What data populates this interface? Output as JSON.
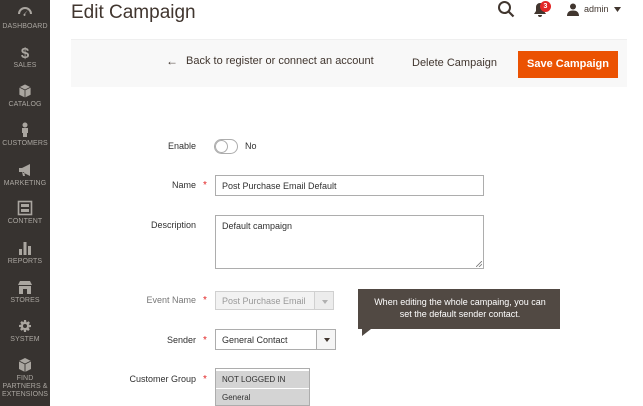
{
  "sidebar": {
    "items": [
      {
        "label": "Dashboard",
        "icon": "dashboard-icon"
      },
      {
        "label": "Sales",
        "icon": "dollar-icon"
      },
      {
        "label": "Catalog",
        "icon": "box-icon"
      },
      {
        "label": "Customers",
        "icon": "person-icon"
      },
      {
        "label": "Marketing",
        "icon": "megaphone-icon"
      },
      {
        "label": "Content",
        "icon": "layout-icon"
      },
      {
        "label": "Reports",
        "icon": "bar-chart-icon"
      },
      {
        "label": "Stores",
        "icon": "store-icon"
      },
      {
        "label": "System",
        "icon": "gear-icon"
      },
      {
        "label": "Find Partners & Extensions",
        "icon": "cube-icon"
      }
    ]
  },
  "header": {
    "title": "Edit Campaign",
    "notification_count": "3",
    "user_name": "admin"
  },
  "actions": {
    "back_label": "Back to register or connect an account",
    "back_arrow": "←",
    "delete_label": "Delete Campaign",
    "save_label": "Save Campaign"
  },
  "form": {
    "enable_label": "Enable",
    "enable_value": "No",
    "name_label": "Name",
    "name_value": "Post Purchase Email Default",
    "description_label": "Description",
    "description_value": "Default campaign",
    "event_name_label": "Event Name",
    "event_name_value": "Post Purchase Email",
    "sender_label": "Sender",
    "sender_value": "General Contact",
    "sender_tooltip": "When editing the whole campaing, you can set the default sender contact.",
    "customer_group_label": "Customer Group",
    "customer_group_options": [
      "NOT LOGGED IN",
      "General"
    ]
  },
  "colors": {
    "sidebar_bg": "#373330",
    "accent": "#eb5202",
    "required": "#e22626",
    "tooltip_bg": "#514943"
  }
}
